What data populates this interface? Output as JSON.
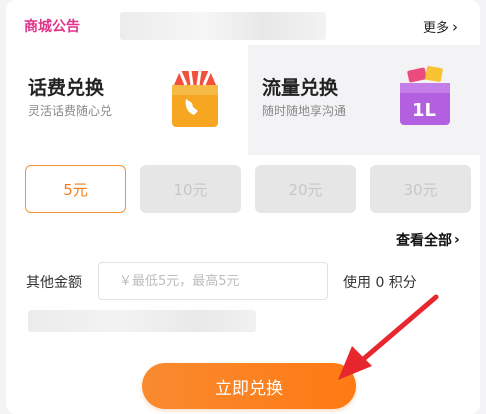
{
  "notice": {
    "tag": "商城公告",
    "more": "更多"
  },
  "tabs": [
    {
      "title": "话费兑换",
      "subtitle": "灵活话费随心兑",
      "icon": "shopping-bag-phone-icon"
    },
    {
      "title": "流量兑换",
      "subtitle": "随时随地享沟通",
      "icon": "data-box-icon",
      "icon_text": "1L"
    }
  ],
  "amounts": [
    "5元",
    "10元",
    "20元",
    "30元"
  ],
  "selected_amount": "5元",
  "view_all": "查看全部",
  "other_amount": {
    "label": "其他金额",
    "placeholder": "￥最低5元，最高5元",
    "value": ""
  },
  "points_text": "使用 0 积分",
  "submit": "立即兑换",
  "colors": {
    "accent": "#f07c1a",
    "notice": "#e0338a",
    "arrow": "#e8262d"
  }
}
